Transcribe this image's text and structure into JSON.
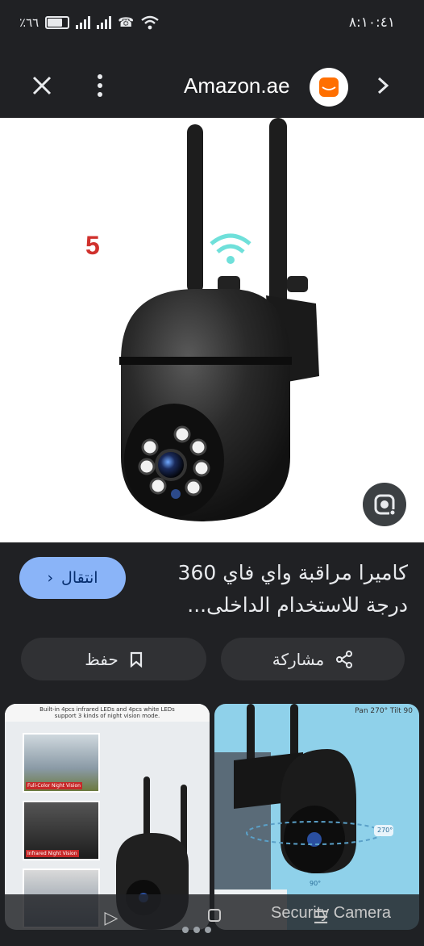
{
  "status_bar": {
    "time": "٨:١٠:٤١",
    "battery": "٪٦٦"
  },
  "toolbar": {
    "title": "Amazon.ae",
    "close_icon": "close-icon",
    "more_icon": "more-vert-icon",
    "forward_icon": "chevron-right-icon"
  },
  "hero": {
    "overlay_number": "5"
  },
  "result": {
    "title": "كاميرا مراقبة واي فاي 360 درجة للاستخدام الداخلى...",
    "visit_label": "انتقال",
    "save_label": "حفظ",
    "share_label": "مشاركة"
  },
  "thumbnails": {
    "left": {
      "top_text": "Built-in 4pcs infrared LEDs and 4pcs white LEDs support 3 kinds of night vision mode.",
      "labels": [
        "Full-Color Night Vision",
        "Infrared Night Vision"
      ]
    },
    "right": {
      "top_text": "Pan 270° Tilt 90",
      "angle_label": "270°",
      "bottom_angle": "90°"
    }
  },
  "bottom": {
    "caption": "Security Camera"
  },
  "colors": {
    "background": "#202124",
    "accent": "#8ab4f8",
    "amazon_orange": "#ff6f00"
  }
}
